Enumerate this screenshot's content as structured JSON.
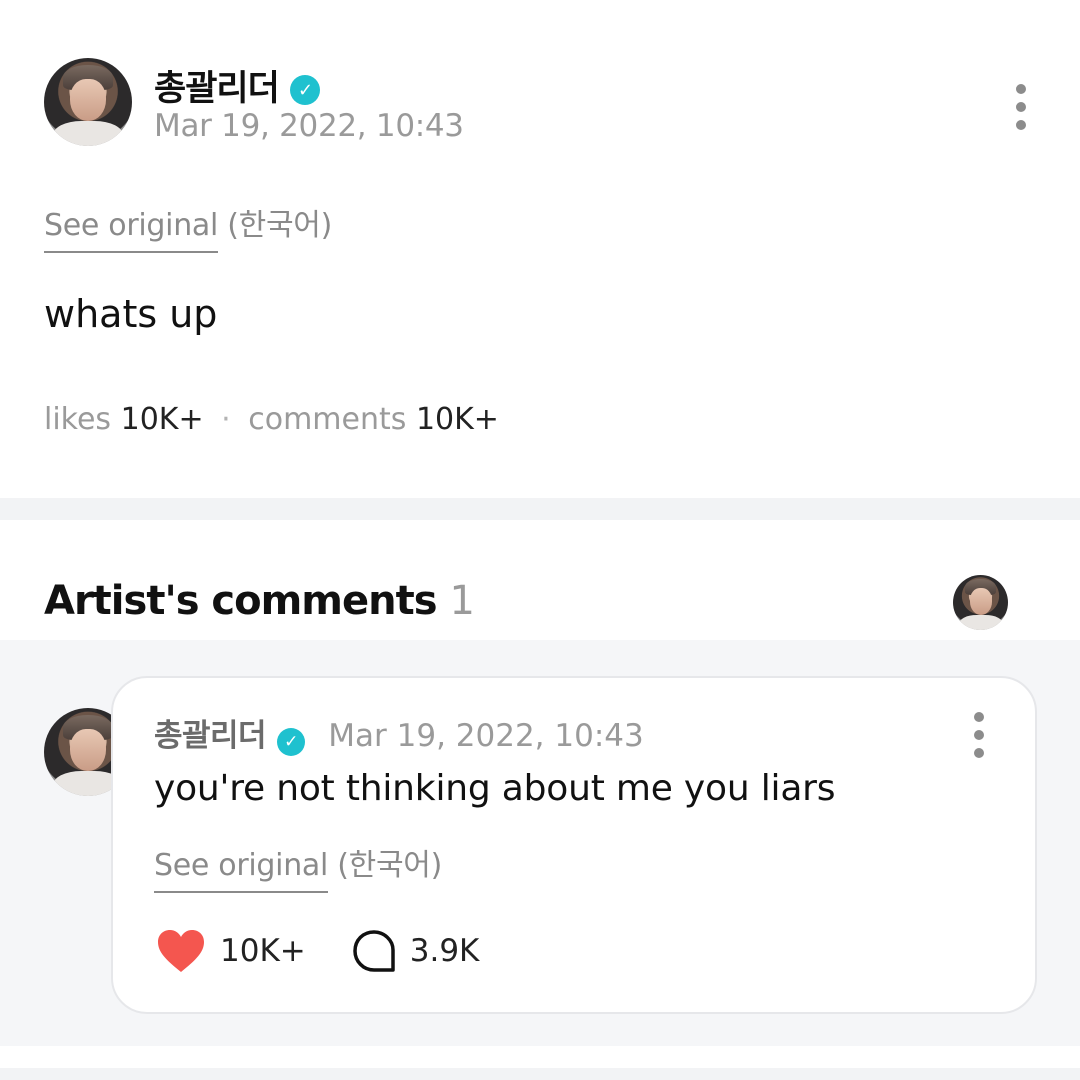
{
  "post": {
    "author": "총괄리더",
    "date": "Mar 19, 2022, 10:43",
    "see_original": "See original",
    "original_language": "(한국어)",
    "text": "whats up",
    "likes_label": "likes",
    "likes_value": "10K+",
    "separator": "·",
    "comments_label": "comments",
    "comments_value": "10K+"
  },
  "artist_comments": {
    "title": "Artist's comments",
    "count": "1",
    "comment": {
      "author": "총괄리더",
      "date": "Mar 19, 2022, 10:43",
      "text": "you're not thinking about me you liars",
      "see_original": "See original",
      "original_language": "(한국어)",
      "likes": "10K+",
      "replies": "3.9K"
    }
  },
  "colors": {
    "verified": "#1fc1cf",
    "heart": "#f4564f",
    "muted": "#9a9a9a",
    "section_bg": "#f5f6f8"
  },
  "icons": [
    "verified-badge-icon",
    "more-options-icon",
    "heart-icon",
    "comment-bubble-icon"
  ]
}
